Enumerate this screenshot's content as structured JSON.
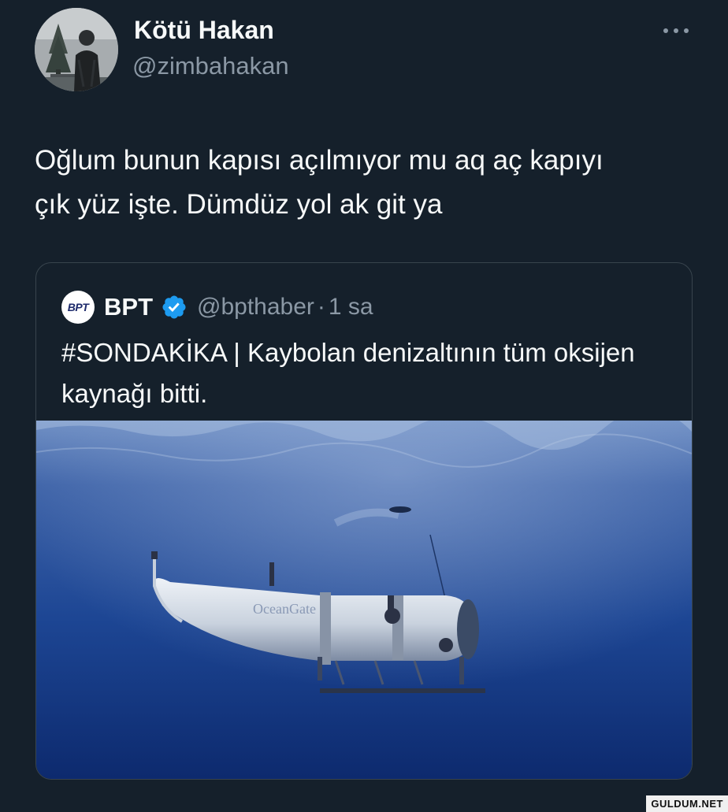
{
  "tweet": {
    "author": {
      "display_name": "Kötü Hakan",
      "handle": "@zimbahakan",
      "avatar_icon": "profile-photo"
    },
    "more_icon": "more-horizontal-icon",
    "text": "Oğlum bunun kapısı açılmıyor mu aq aç kapıyı\nçık yüz işte. Dümdüz yol ak git ya"
  },
  "quote": {
    "avatar_text": "BPT",
    "display_name": "BPT",
    "verified_icon": "verified-badge-icon",
    "verified_color": "#1d9bf0",
    "handle": "@bpthaber",
    "separator": "·",
    "time": "1 sa",
    "text": "#SONDAKİKA | Kaybolan denizaltının tüm oksijen kaynağı bitti.",
    "media": {
      "description_icon": "submarine-photo",
      "hull_text": "OceanGate"
    }
  },
  "watermark": "GULDUM.NET",
  "colors": {
    "background": "#15202b",
    "text_primary": "#f7f9f9",
    "text_secondary": "#8b98a5",
    "border": "#38444d"
  }
}
